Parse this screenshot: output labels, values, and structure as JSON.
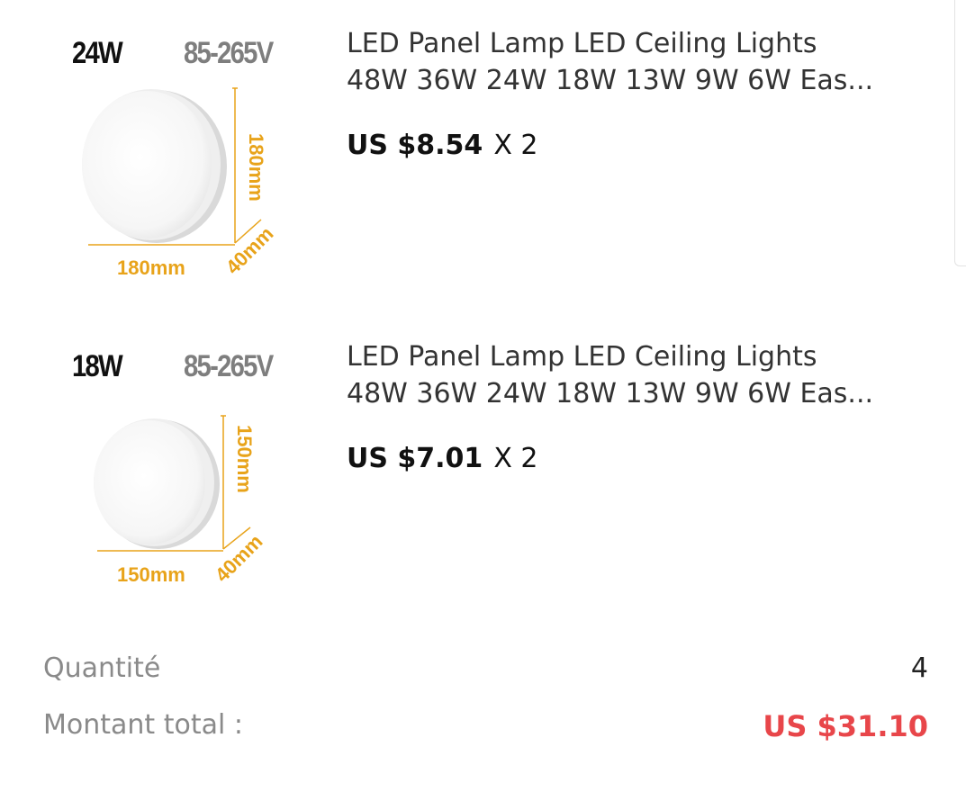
{
  "items": [
    {
      "image": {
        "power": "24W",
        "voltage": "85-265V",
        "height_label": "180mm",
        "width_label": "180mm",
        "depth_label": "40mm"
      },
      "title_line1": "LED Panel Lamp LED Ceiling Lights",
      "title_line2": "48W 36W 24W 18W 13W 9W 6W Eas...",
      "price": "US $8.54",
      "quantity": "X 2"
    },
    {
      "image": {
        "power": "18W",
        "voltage": "85-265V",
        "height_label": "150mm",
        "width_label": "150mm",
        "depth_label": "40mm"
      },
      "title_line1": "LED Panel Lamp LED Ceiling Lights",
      "title_line2": "48W 36W 24W 18W 13W 9W 6W Eas...",
      "price": "US $7.01",
      "quantity": "X 2"
    }
  ],
  "summary": {
    "quantity_label": "Quantité",
    "quantity_value": "4",
    "total_label": "Montant total :",
    "total_value": "US $31.10"
  },
  "colors": {
    "dimension_accent": "#e8a31a",
    "total_price": "#e8464a",
    "muted_label": "#8a8a8a"
  }
}
